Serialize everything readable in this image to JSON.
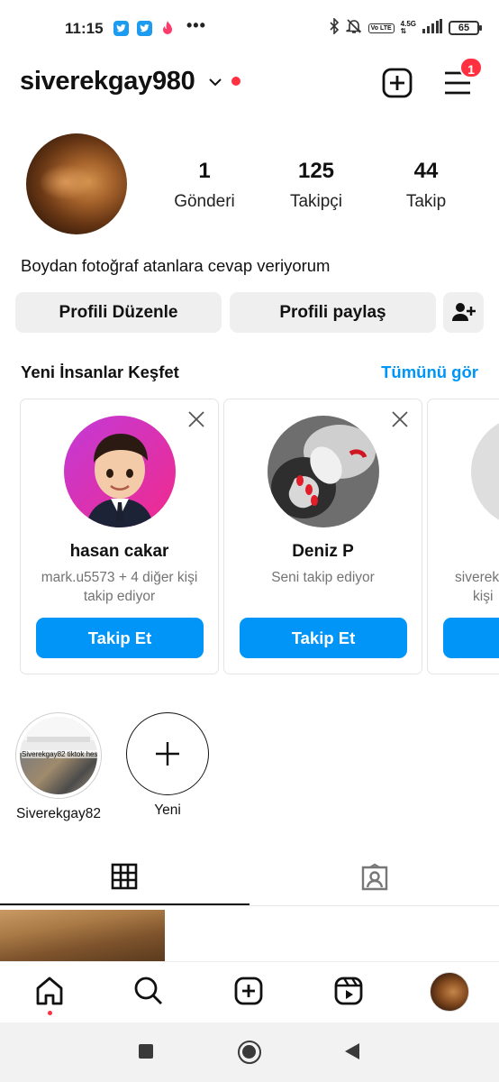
{
  "status_bar": {
    "time": "11:15",
    "dots": "•••",
    "network_top": "4.5G",
    "volte": "Vo LTE",
    "battery": "65",
    "icons": [
      "twitter-icon",
      "twitter-icon",
      "tinder-icon",
      "bluetooth-icon",
      "mute-bell-icon",
      "signal-icon",
      "battery-icon"
    ]
  },
  "header": {
    "username": "siverekgay980",
    "notification_count": "1",
    "accent_red": "#ff3040"
  },
  "profile": {
    "posts_count": "1",
    "posts_label": "Gönderi",
    "followers_count": "125",
    "followers_label": "Takipçi",
    "following_count": "44",
    "following_label": "Takip",
    "bio": "Boydan fotoğraf atanlara cevap veriyorum",
    "edit_button": "Profili Düzenle",
    "share_button": "Profili paylaş"
  },
  "discover": {
    "title": "Yeni İnsanlar Keşfet",
    "see_all": "Tümünü gör",
    "link_color": "#0095f6",
    "cards": [
      {
        "name": "hasan cakar",
        "subtitle": "mark.u5573 + 4 diğer kişi takip ediyor",
        "follow": "Takip Et"
      },
      {
        "name": "Deniz P",
        "subtitle": "Seni takip ediyor",
        "follow": "Takip Et"
      },
      {
        "name": "",
        "subtitle_line1": "siverek",
        "subtitle_line2": "kişi",
        "follow": "T"
      }
    ]
  },
  "highlights": [
    {
      "label": "Siverekgay82",
      "thumb_text": "Siverekgay82 tiktok hesabim"
    },
    {
      "label": "Yeni"
    }
  ],
  "tabs": [
    {
      "name": "grid",
      "icon": "grid-icon",
      "active": true
    },
    {
      "name": "tagged",
      "icon": "tagged-person-icon",
      "active": false
    }
  ],
  "bottom_nav": [
    {
      "icon": "home-icon",
      "active": true
    },
    {
      "icon": "search-icon"
    },
    {
      "icon": "create-icon"
    },
    {
      "icon": "reels-icon"
    },
    {
      "icon": "profile-avatar-icon"
    }
  ],
  "system_nav": [
    "recents-button",
    "home-button",
    "back-button"
  ]
}
